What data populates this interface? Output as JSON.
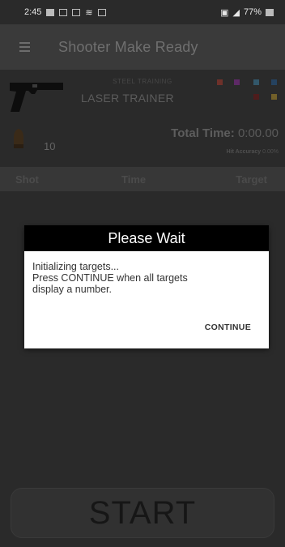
{
  "status_bar": {
    "time": "2:45",
    "battery": "77%"
  },
  "app_bar": {
    "menu_icon": "hamburger-menu-icon",
    "title": "Shooter Make Ready"
  },
  "trainer_info": {
    "brand_text": "STEEL TRAINING",
    "trainer_name": "LASER TRAINER",
    "round_count": "10",
    "total_time_label": "Total Time:",
    "total_time_value": "0:00.00",
    "hit_accuracy_label": "Hit Accuracy",
    "hit_accuracy_value": "0.00%",
    "target_colors": [
      "#c0392b",
      "#9b27b0",
      "#3b8fb8",
      "#1f5f9f",
      "#7a0c0c",
      "#c9a227"
    ]
  },
  "table": {
    "headers": [
      "Shot",
      "Time",
      "Target"
    ]
  },
  "dialog": {
    "title": "Please Wait",
    "message_lines": [
      "Initializing targets...",
      "Press CONTINUE when all targets",
      "display a number."
    ],
    "continue_label": "CONTINUE"
  },
  "start_button": {
    "label": "START"
  }
}
